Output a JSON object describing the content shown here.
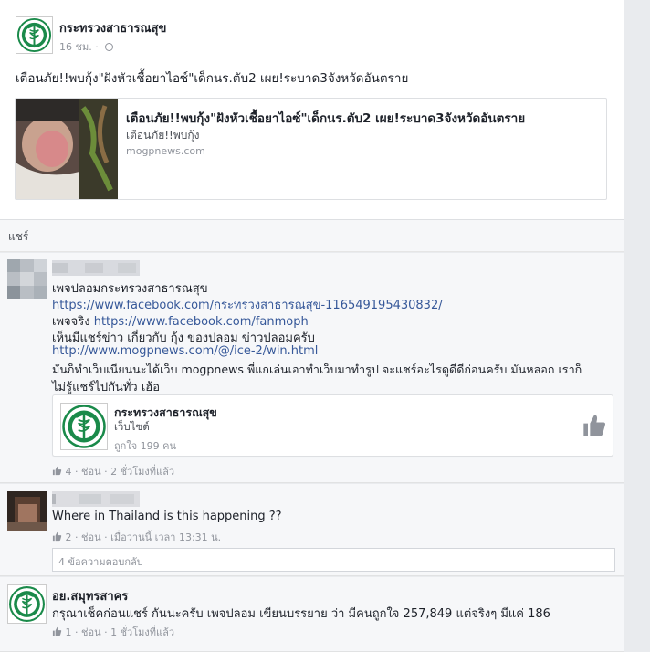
{
  "post": {
    "page_name": "กระทรวงสาธารณสุข",
    "time": "16 ชม.",
    "dot": "·",
    "text": "เตือนภัย!!พบกุ้ง\"ฝังหัวเชื้อยาไอซ์\"เด็กนร.ตับ2 เผย!ระบาด3จังหวัดอันตราย",
    "link": {
      "title": "เตือนภัย!!พบกุ้ง\"ฝังหัวเชื้อยาไอซ์\"เด็กนร.ตับ2 เผย!ระบาด3จังหวัดอันตราย",
      "description": "เตือนภัย!!พบกุ้ง",
      "domain": "mogpnews.com"
    }
  },
  "shares": {
    "label": "แชร์",
    "items": [
      {
        "lines": {
          "l1": "เพจปลอมกระทรวงสาธารณสุข",
          "l2": "https://www.facebook.com/กระทรวงสาธารณสุข-116549195430832/",
          "l3_prefix": "เพจจริง ",
          "l3_link": "https://www.facebook.com/fanmoph",
          "l4": "เห็นมีแชร์ข่าว เกี่ยวกับ กุ้ง ของปลอม ข่าวปลอมครับ",
          "l5": "http://www.mogpnews.com/@/ice-2/win.html",
          "l6": "มันก็ทำเว็บเนียนนะได้เว็บ mogpnews พี่แกเล่นเอาทำเว็บมาทำรูป จะแชร์อะไรดูดีดีก่อนครับ มันหลอก เราก็",
          "l7": "ไม่รู้แชร์ไปกันทั่ว เฮ้อ"
        },
        "page_card": {
          "name": "กระทรวงสาธารณสุข",
          "type": "เว็บไซต์",
          "likes": "ถูกใจ 199 คน"
        },
        "actions": {
          "likes": "4",
          "sep1": " · ",
          "reply": "ช่อน",
          "sep2": " · ",
          "time": "2 ชั่วโมงที่แล้ว"
        }
      },
      {
        "text": "Where in Thailand is this happening ??",
        "actions": {
          "likes": "2",
          "sep1": " · ",
          "reply": "ช่อน",
          "sep2": " · ",
          "time": "เมื่อวานนี้ เวลา 13:31 น."
        },
        "replies": "4 ข้อความตอบกลับ"
      },
      {
        "name": "อย.สมุทรสาคร",
        "text": "กรุณาเช็คก่อนแชร์ กันนะครับ เพจปลอม เขียนบรรยาย ว่า มีคนถูกใจ 257,849 แต่จริงๆ มีแค่ 186",
        "actions": {
          "likes": "1",
          "sep1": " · ",
          "reply": "ช่อน",
          "sep2": " · ",
          "time": "1 ชั่วโมงที่แล้ว"
        }
      }
    ]
  },
  "colors": {
    "link": "#365899",
    "meta": "#90949c",
    "logo_green": "#1a8a4a"
  }
}
